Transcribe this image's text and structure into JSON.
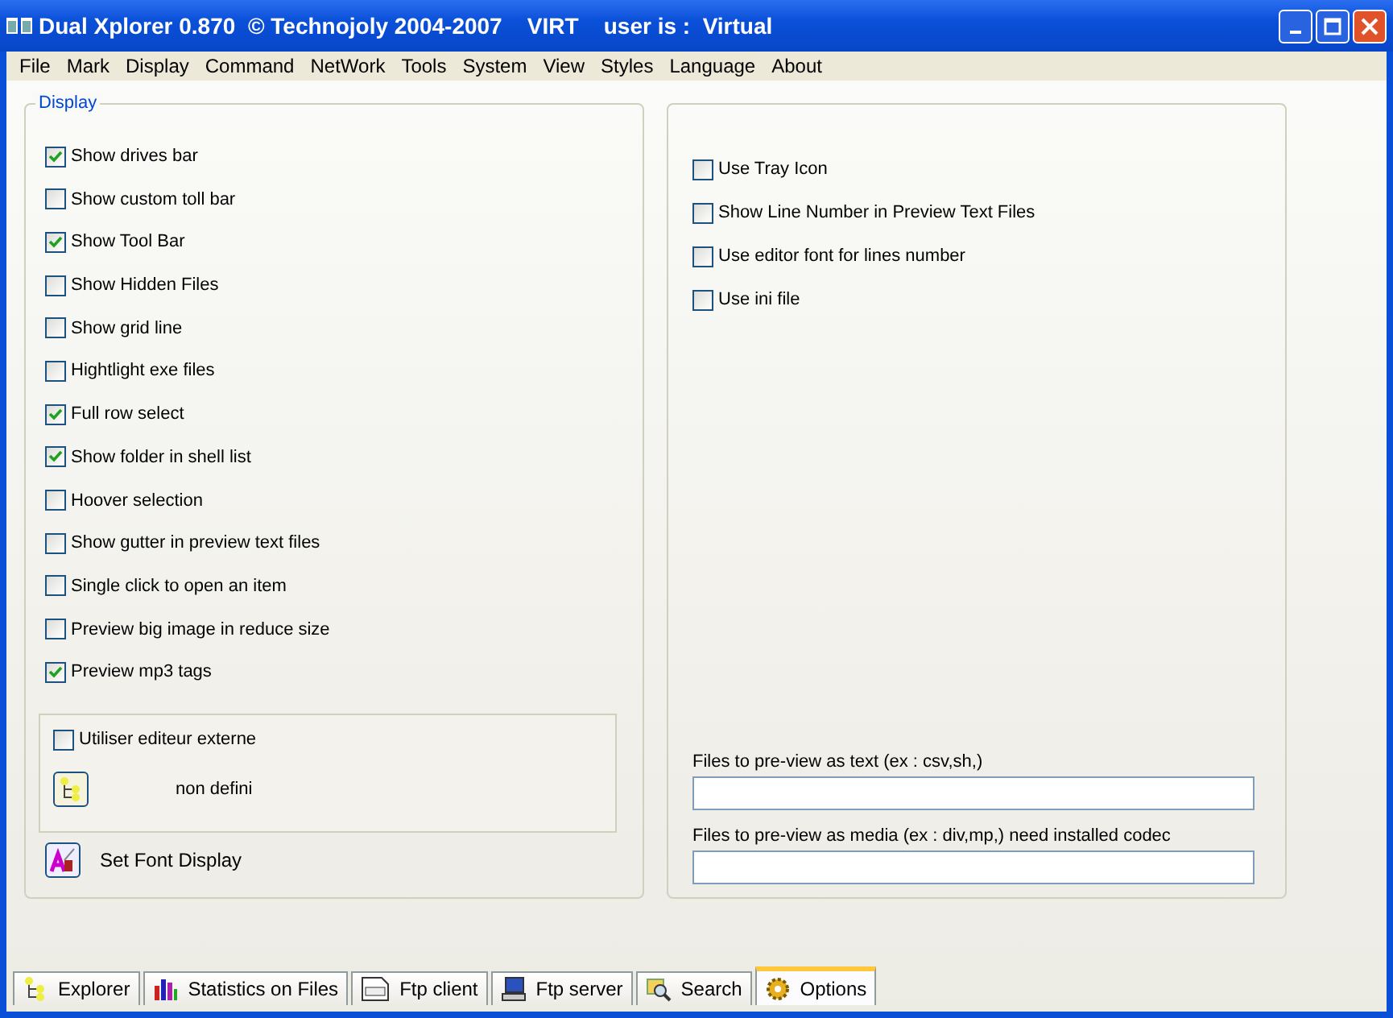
{
  "window": {
    "title": "Dual Xplorer 0.870  © Technojoly 2004-2007    VIRT    user is :  Virtual"
  },
  "menu": [
    "File",
    "Mark",
    "Display",
    "Command",
    "NetWork",
    "Tools",
    "System",
    "View",
    "Styles",
    "Language",
    "About"
  ],
  "display_group": {
    "title": "Display",
    "options": [
      {
        "label": "Show drives bar",
        "checked": true
      },
      {
        "label": "Show custom toll bar",
        "checked": false
      },
      {
        "label": "Show Tool Bar",
        "checked": true
      },
      {
        "label": "Show Hidden Files",
        "checked": false
      },
      {
        "label": "Show grid line",
        "checked": false
      },
      {
        "label": "Hightlight exe files",
        "checked": false
      },
      {
        "label": "Full row select",
        "checked": true
      },
      {
        "label": "Show folder in shell list",
        "checked": true
      },
      {
        "label": "Hoover selection",
        "checked": false
      },
      {
        "label": "Show gutter in preview text files",
        "checked": false
      },
      {
        "label": "Single click to open an item",
        "checked": false
      },
      {
        "label": "Preview big image in reduce size",
        "checked": false
      },
      {
        "label": "Preview mp3 tags",
        "checked": true
      }
    ],
    "external_editor": {
      "label": "Utiliser editeur externe",
      "checked": false,
      "path": "non defini"
    },
    "font_button": "Set Font Display"
  },
  "right_panel": {
    "options": [
      {
        "label": "Use Tray Icon",
        "checked": false
      },
      {
        "label": "Show Line Number in Preview Text Files",
        "checked": false
      },
      {
        "label": "Use editor font for lines number",
        "checked": false
      },
      {
        "label": "Use ini file",
        "checked": false
      }
    ],
    "fields": [
      {
        "label": "Files to pre-view as text (ex : csv,sh,)"
      },
      {
        "label": "Files to pre-view as media (ex : div,mp,) need installed codec"
      }
    ]
  },
  "tabs": [
    {
      "label": "Explorer",
      "selected": false
    },
    {
      "label": "Statistics on Files",
      "selected": false
    },
    {
      "label": "Ftp client",
      "selected": false
    },
    {
      "label": "Ftp server",
      "selected": false
    },
    {
      "label": "Search",
      "selected": false
    },
    {
      "label": "Options",
      "selected": true
    }
  ]
}
